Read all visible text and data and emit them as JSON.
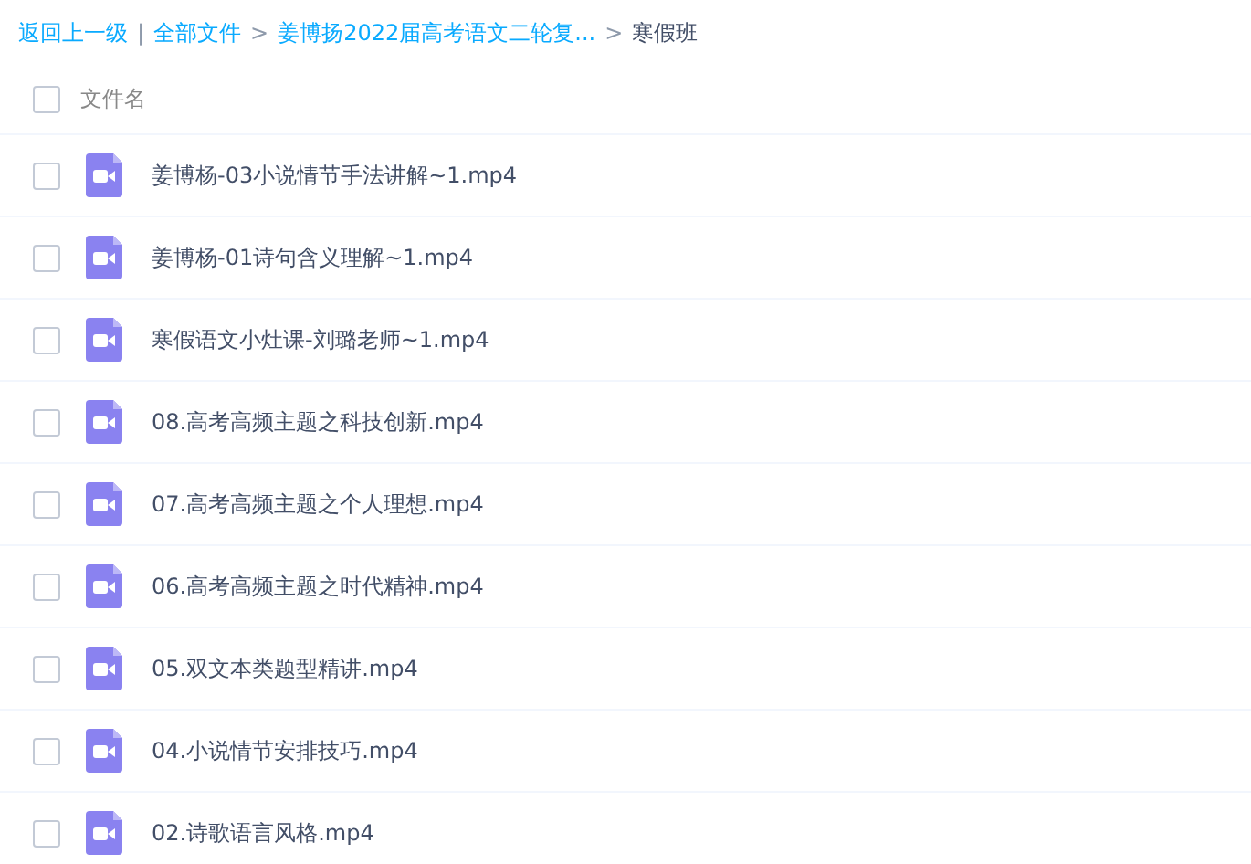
{
  "breadcrumb": [
    {
      "kind": "link",
      "text": "返回上一级"
    },
    {
      "kind": "divider",
      "text": "|"
    },
    {
      "kind": "link",
      "text": "全部文件"
    },
    {
      "kind": "arrow",
      "text": ">"
    },
    {
      "kind": "link",
      "text": "姜博扬2022届高考语文二轮复..."
    },
    {
      "kind": "arrow",
      "text": ">"
    },
    {
      "kind": "current",
      "text": "寒假班"
    }
  ],
  "header": {
    "checked": false,
    "label": "文件名"
  },
  "files": [
    {
      "name": "姜博杨-03小说情节手法讲解~1.mp4",
      "checked": false
    },
    {
      "name": "姜博杨-01诗句含义理解~1.mp4",
      "checked": false
    },
    {
      "name": "寒假语文小灶课-刘璐老师~1.mp4",
      "checked": false
    },
    {
      "name": "08.高考高频主题之科技创新.mp4",
      "checked": false
    },
    {
      "name": "07.高考高频主题之个人理想.mp4",
      "checked": false
    },
    {
      "name": "06.高考高频主题之时代精神.mp4",
      "checked": false
    },
    {
      "name": "05.双文本类题型精讲.mp4",
      "checked": false
    },
    {
      "name": "04.小说情节安排技巧.mp4",
      "checked": false
    },
    {
      "name": "02.诗歌语言风格.mp4",
      "checked": false
    }
  ]
}
